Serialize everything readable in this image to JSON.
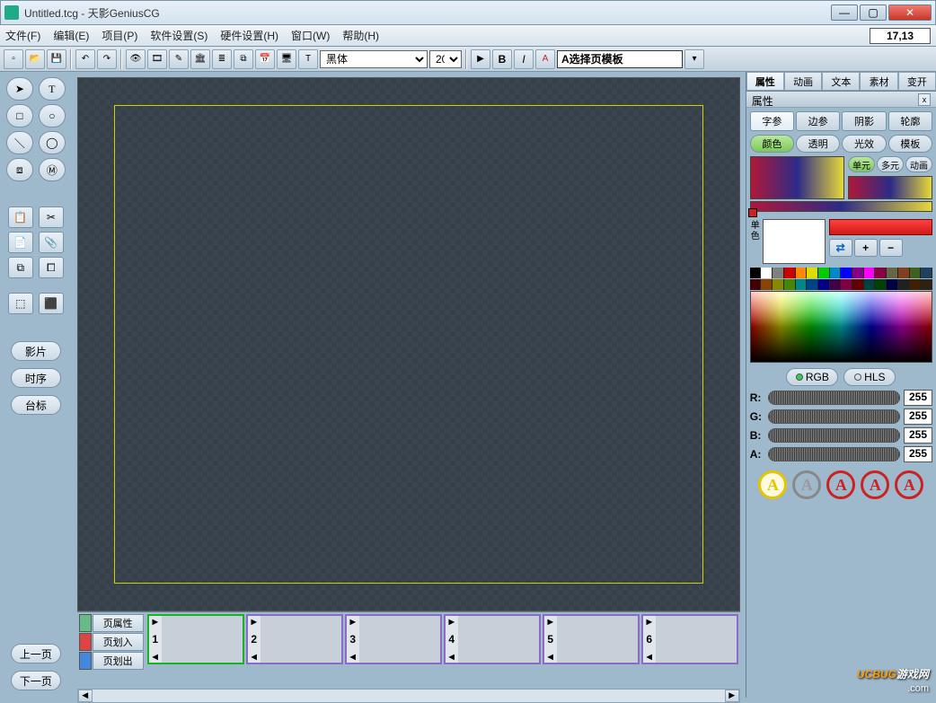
{
  "window": {
    "title": "Untitled.tcg  - 天影GeniusCG"
  },
  "menu": {
    "file": "文件(F)",
    "edit": "编辑(E)",
    "project": "项目(P)",
    "sw": "软件设置(S)",
    "hw": "硬件设置(H)",
    "window": "窗口(W)",
    "help": "帮助(H)"
  },
  "coords": "17,13",
  "toolbar": {
    "font": "黑体",
    "fontsize": "20",
    "template": "A选择页模板"
  },
  "right_tabs": [
    "属性",
    "动画",
    "文本",
    "素材",
    "变开"
  ],
  "right_tabs_active": 0,
  "panel_title": "属性",
  "sub_tabs": [
    "字参",
    "边参",
    "阴影",
    "轮廓"
  ],
  "sub_tabs2": [
    "颜色",
    "透明",
    "光效",
    "模板"
  ],
  "mini_btns": [
    "单元",
    "多元",
    "动画"
  ],
  "single_label": "单色",
  "mode": {
    "rgb": "RGB",
    "hls": "HLS"
  },
  "sliders": {
    "r": {
      "lbl": "R:",
      "val": "255"
    },
    "g": {
      "lbl": "G:",
      "val": "255"
    },
    "b": {
      "lbl": "B:",
      "val": "255"
    },
    "a": {
      "lbl": "A:",
      "val": "255"
    }
  },
  "left_side": {
    "movie": "影片",
    "timeline": "时序",
    "station": "台标",
    "prev": "上一页",
    "next": "下一页"
  },
  "tl_left": {
    "attr": "页属性",
    "in": "页划入",
    "out": "页划出"
  },
  "frames": [
    "1",
    "2",
    "3",
    "4",
    "5",
    "6"
  ],
  "palette_row1": [
    "#000",
    "#fff",
    "#808080",
    "#c00",
    "#f80",
    "#dd0",
    "#0c0",
    "#08c",
    "#00f",
    "#808",
    "#f0f",
    "#804",
    "#664",
    "#804020",
    "#406020",
    "#204060"
  ],
  "palette_row2": [
    "#400",
    "#840",
    "#880",
    "#480",
    "#088",
    "#048",
    "#008",
    "#404",
    "#800040",
    "#600",
    "#004040",
    "#004000",
    "#000040",
    "#202020",
    "#402000",
    "#302010"
  ],
  "watermark": {
    "brand_a": "UCBUG",
    "brand_b": "游戏网",
    "domain": ".com"
  }
}
